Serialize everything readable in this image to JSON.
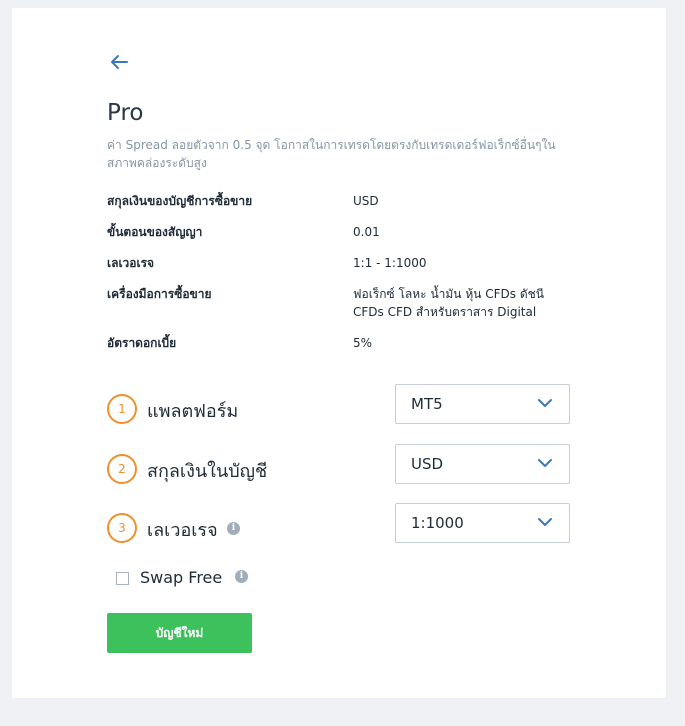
{
  "page": {
    "title": "Pro",
    "subtitle": "ค่า Spread ลอยตัวจาก 0.5 จุด โอกาสในการเทรดโดยตรงกับเทรดเดอร์ฟอเร็กซ์อื่นๆในสภาพคล่องระดับสูง"
  },
  "specs": [
    {
      "label": "สกุลเงินของบัญชีการซื้อขาย",
      "value": "USD"
    },
    {
      "label": "ขั้นตอนของสัญญา",
      "value": "0.01"
    },
    {
      "label": "เลเวอเรจ",
      "value": "1:1 - 1:1000"
    },
    {
      "label": "เครื่องมือการซื้อขาย",
      "value": "ฟอเร็กซ์ โลหะ น้ำมัน หุ้น CFDs ดัชนี CFDs CFD สำหรับตราสาร Digital"
    },
    {
      "label": "อัตราดอกเบี้ย",
      "value": "5%"
    }
  ],
  "steps": [
    {
      "number": "1",
      "label": "แพลตฟอร์ม",
      "value": "MT5"
    },
    {
      "number": "2",
      "label": "สกุลเงินในบัญชี",
      "value": "USD"
    },
    {
      "number": "3",
      "label": "เลเวอเรจ",
      "value": "1:1000"
    }
  ],
  "icons": {
    "back": "arrow-left-icon",
    "info": "info-icon",
    "chevron": "chevron-down-icon"
  },
  "swap_free": {
    "label": "Swap Free",
    "checked": false
  },
  "submit": {
    "label": "บัญชีใหม่"
  },
  "colors": {
    "accent": "#f0902c",
    "primary_button": "#3cc15c",
    "back_arrow": "#3b78b8",
    "chevron": "#3b78b8"
  }
}
